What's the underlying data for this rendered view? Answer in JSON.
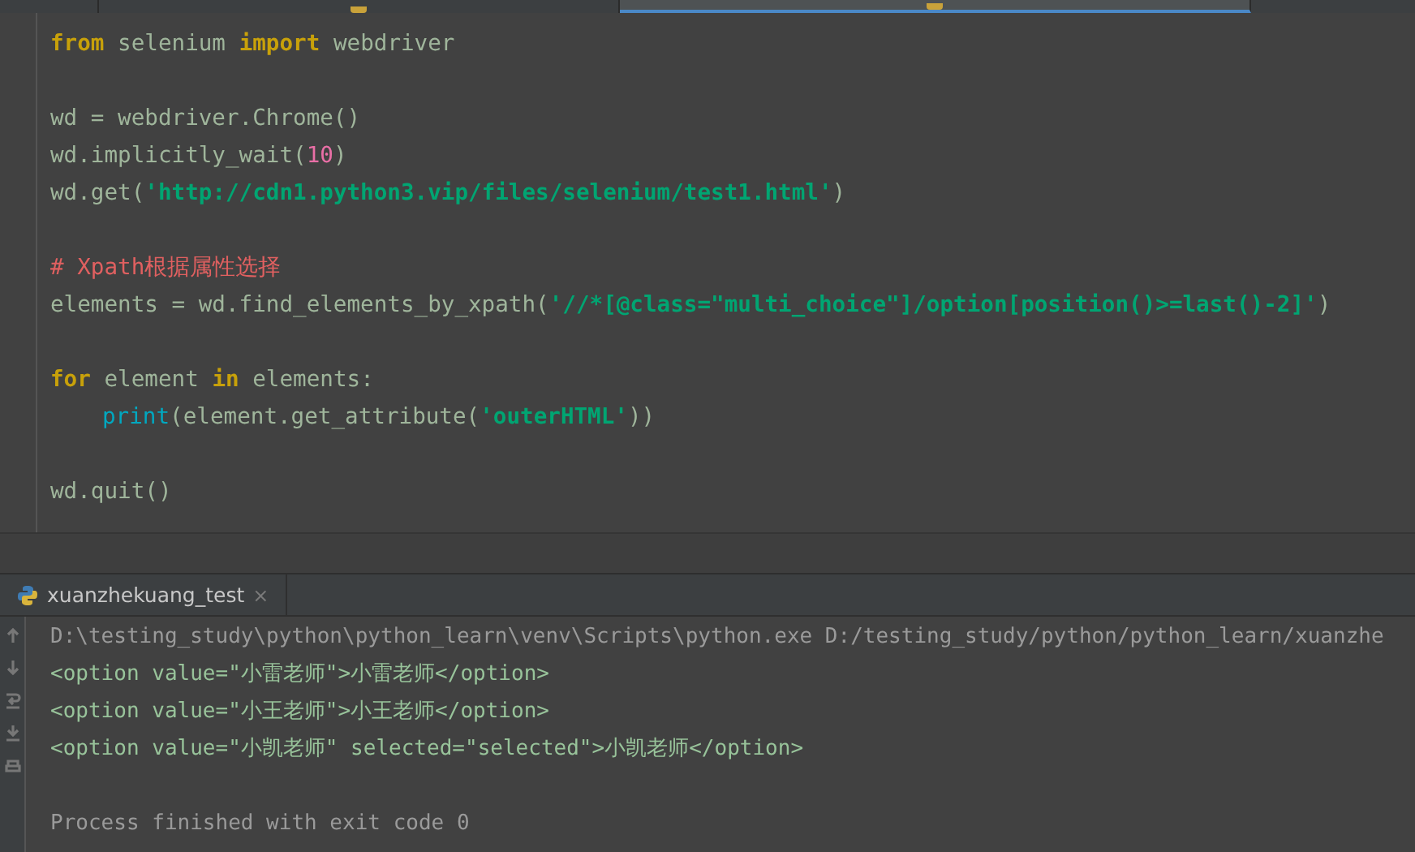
{
  "editor_tabs": [
    {
      "selected": false
    },
    {
      "selected": false
    },
    {
      "selected": true
    }
  ],
  "code_lines": [
    {
      "tokens": [
        {
          "kind": "keyword",
          "text": "from"
        },
        {
          "kind": "plain",
          "text": " selenium "
        },
        {
          "kind": "keyword",
          "text": "import"
        },
        {
          "kind": "plain",
          "text": " webdriver"
        }
      ]
    },
    {
      "space_before": true,
      "tokens": [
        {
          "kind": "plain",
          "text": "wd = webdriver.Chrome()"
        }
      ]
    },
    {
      "tokens": [
        {
          "kind": "plain",
          "text": "wd.implicitly_wait("
        },
        {
          "kind": "number",
          "text": "10"
        },
        {
          "kind": "plain",
          "text": ")"
        }
      ]
    },
    {
      "tokens": [
        {
          "kind": "plain",
          "text": "wd.get("
        },
        {
          "kind": "string",
          "text": "'http://cdn1.python3.vip/files/selenium/test1.html'"
        },
        {
          "kind": "plain",
          "text": ")"
        }
      ]
    },
    {
      "space_before": true,
      "tokens": [
        {
          "kind": "comment",
          "text": "# Xpath根据属性选择"
        }
      ]
    },
    {
      "tokens": [
        {
          "kind": "plain",
          "text": "elements = wd.find_elements_by_xpath("
        },
        {
          "kind": "string",
          "text": "'//*[@class=\"multi_choice\"]/option[position()>=last()-2]'"
        },
        {
          "kind": "plain",
          "text": ")"
        }
      ]
    },
    {
      "space_before": true,
      "tokens": [
        {
          "kind": "keyword",
          "text": "for"
        },
        {
          "kind": "plain",
          "text": " element "
        },
        {
          "kind": "keyword",
          "text": "in"
        },
        {
          "kind": "plain",
          "text": " elements:"
        }
      ]
    },
    {
      "indent": true,
      "tokens": [
        {
          "kind": "builtin",
          "text": "print"
        },
        {
          "kind": "plain",
          "text": "(element.get_attribute("
        },
        {
          "kind": "string",
          "text": "'outerHTML'"
        },
        {
          "kind": "plain",
          "text": "))"
        }
      ]
    },
    {
      "space_before": true,
      "tokens": [
        {
          "kind": "plain",
          "text": "wd.quit()"
        }
      ]
    }
  ],
  "run_tab": {
    "label": "xuanzhekuang_test",
    "close": "×"
  },
  "console_lines": [
    {
      "kind": "command",
      "text": "D:\\testing_study\\python\\python_learn\\venv\\Scripts\\python.exe D:/testing_study/python/python_learn/xuanzhe"
    },
    {
      "kind": "output",
      "text": "<option value=\"小雷老师\">小雷老师</option>"
    },
    {
      "kind": "output",
      "text": "<option value=\"小王老师\">小王老师</option>"
    },
    {
      "kind": "output",
      "text": "<option value=\"小凯老师\" selected=\"selected\">小凯老师</option>"
    },
    {
      "kind": "status",
      "space_before": true,
      "text": "Process finished with exit code 0"
    }
  ]
}
